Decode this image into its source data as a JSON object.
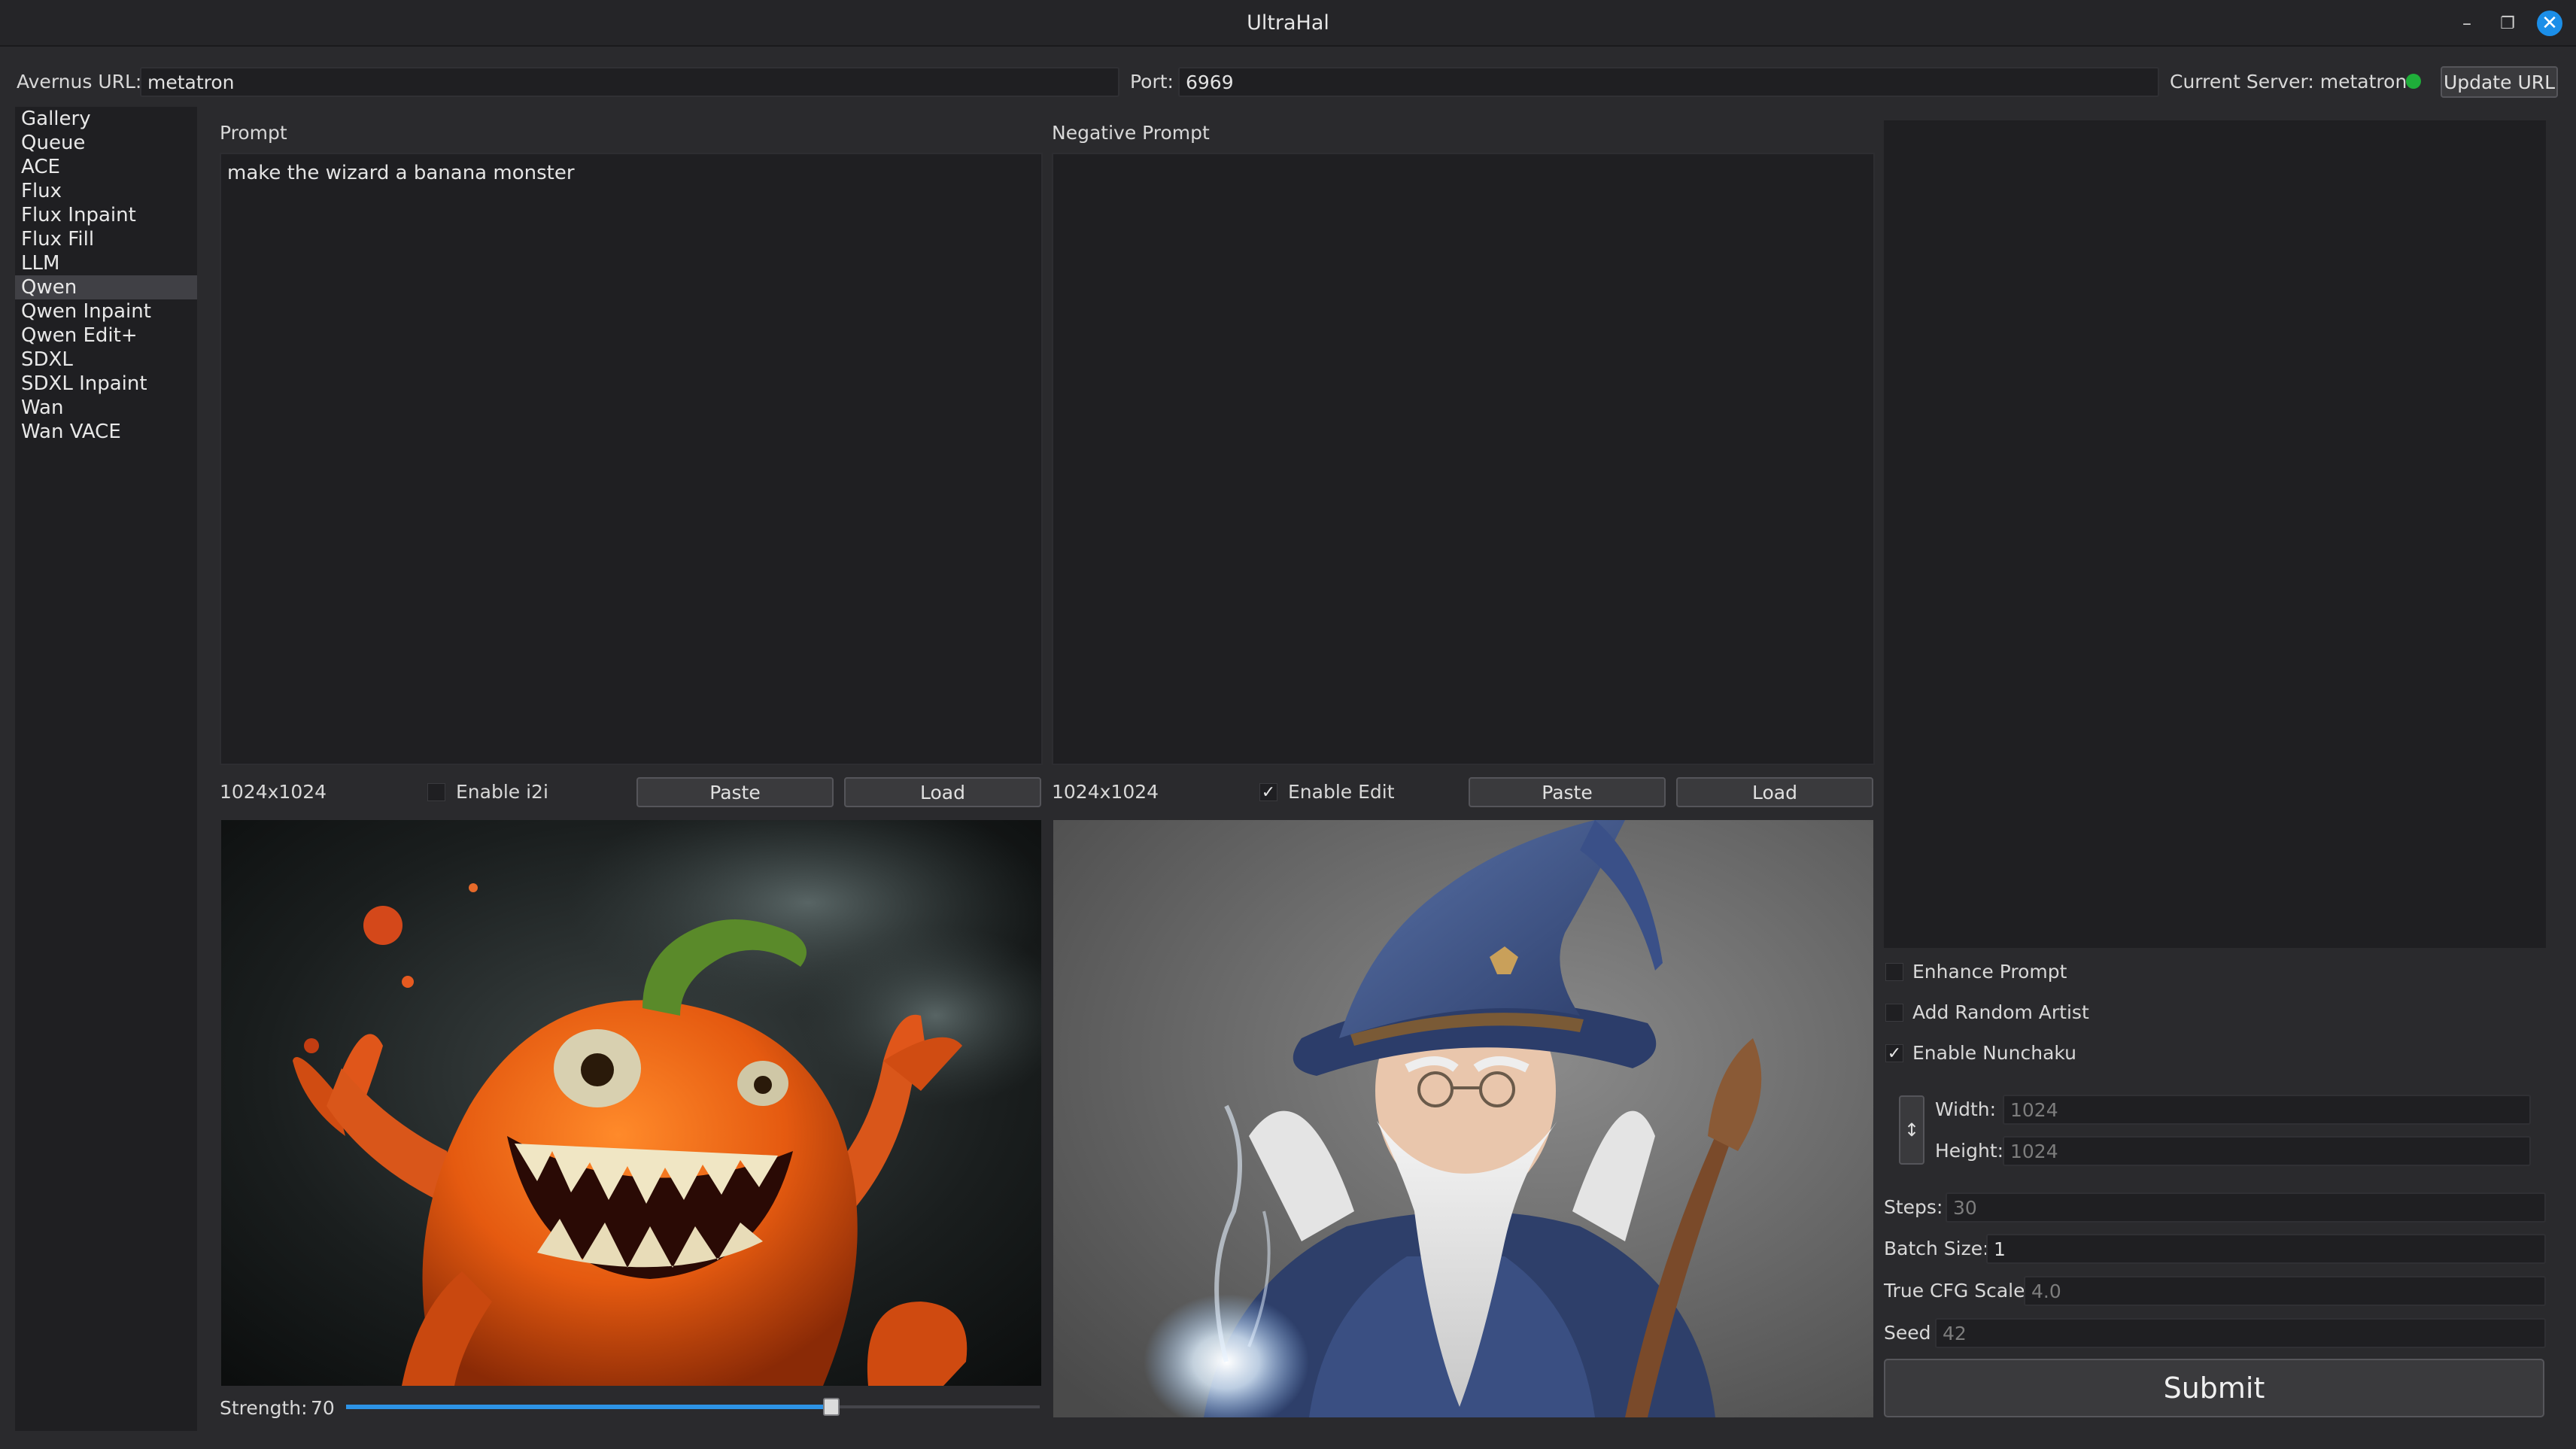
{
  "window": {
    "title": "UltraHal"
  },
  "urlbar": {
    "avernus_label": "Avernus URL:",
    "avernus_value": "metatron",
    "port_label": "Port:",
    "port_value": "6969",
    "server_status": "Current Server: metatron",
    "update_label": "Update URL",
    "status_color": "#1fae3a"
  },
  "sidebar": {
    "items": [
      {
        "label": "Gallery"
      },
      {
        "label": "Queue"
      },
      {
        "label": "ACE"
      },
      {
        "label": "Flux"
      },
      {
        "label": "Flux Inpaint"
      },
      {
        "label": "Flux Fill"
      },
      {
        "label": "LLM"
      },
      {
        "label": "Qwen"
      },
      {
        "label": "Qwen Inpaint"
      },
      {
        "label": "Qwen Edit+"
      },
      {
        "label": "SDXL"
      },
      {
        "label": "SDXL Inpaint"
      },
      {
        "label": "Wan"
      },
      {
        "label": "Wan VACE"
      }
    ],
    "active": "Qwen"
  },
  "prompt": {
    "label": "Prompt",
    "value": "make the wizard a banana monster"
  },
  "negative": {
    "label": "Negative Prompt",
    "value": ""
  },
  "left_image": {
    "size": "1024x1024",
    "toggle_label": "Enable i2i",
    "toggle_checked": false,
    "paste_label": "Paste",
    "load_label": "Load",
    "strength_label": "Strength:",
    "strength_value": "70",
    "strength_fraction": 0.7
  },
  "right_image": {
    "size": "1024x1024",
    "toggle_label": "Enable Edit",
    "toggle_checked": true,
    "paste_label": "Paste",
    "load_label": "Load"
  },
  "options": {
    "enhance_label": "Enhance Prompt",
    "enhance_checked": false,
    "random_artist_label": "Add Random Artist",
    "random_artist_checked": false,
    "nunchaku_label": "Enable Nunchaku",
    "nunchaku_checked": true
  },
  "params": {
    "width_label": "Width:",
    "width_value": "1024",
    "height_label": "Height:",
    "height_value": "1024",
    "steps_label": "Steps:",
    "steps_value": "30",
    "batch_label": "Batch Size:",
    "batch_value": "1",
    "cfg_label": "True CFG Scale:",
    "cfg_value": "4.0",
    "seed_label": "Seed",
    "seed_value": "42"
  },
  "submit_label": "Submit",
  "icons": {
    "checkmark": "✓",
    "minimize": "–",
    "restore": "❐",
    "close": "✕",
    "swap": "↕"
  }
}
